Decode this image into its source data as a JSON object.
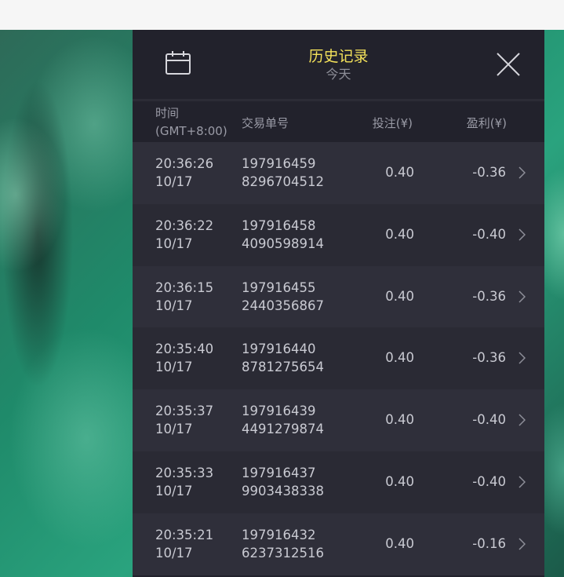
{
  "header": {
    "title": "历史记录",
    "subtitle": "今天",
    "calendar_icon": "calendar-icon",
    "close_icon": "close-icon"
  },
  "columns": {
    "time": "时间",
    "timezone": "(GMT+8:00)",
    "order": "交易单号",
    "bet": "投注(¥)",
    "profit": "盈利(¥)"
  },
  "colors": {
    "panel_bg": "#22222c",
    "title": "#f3e15a",
    "row_a": "#2f2f3a",
    "row_b": "#2a2a34"
  },
  "rows": [
    {
      "time": "20:36:26",
      "date": "10/17",
      "order_a": "197916459",
      "order_b": "8296704512",
      "bet": "0.40",
      "profit": "-0.36"
    },
    {
      "time": "20:36:22",
      "date": "10/17",
      "order_a": "197916458",
      "order_b": "4090598914",
      "bet": "0.40",
      "profit": "-0.40"
    },
    {
      "time": "20:36:15",
      "date": "10/17",
      "order_a": "197916455",
      "order_b": "2440356867",
      "bet": "0.40",
      "profit": "-0.36"
    },
    {
      "time": "20:35:40",
      "date": "10/17",
      "order_a": "197916440",
      "order_b": "8781275654",
      "bet": "0.40",
      "profit": "-0.36"
    },
    {
      "time": "20:35:37",
      "date": "10/17",
      "order_a": "197916439",
      "order_b": "4491279874",
      "bet": "0.40",
      "profit": "-0.40"
    },
    {
      "time": "20:35:33",
      "date": "10/17",
      "order_a": "197916437",
      "order_b": "9903438338",
      "bet": "0.40",
      "profit": "-0.40"
    },
    {
      "time": "20:35:21",
      "date": "10/17",
      "order_a": "197916432",
      "order_b": "6237312516",
      "bet": "0.40",
      "profit": "-0.16"
    }
  ]
}
